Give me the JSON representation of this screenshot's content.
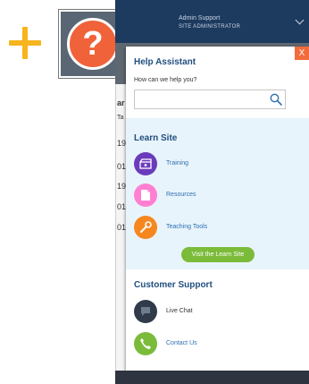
{
  "user": {
    "name": "Admin Support",
    "role": "SITE ADMINISTRATOR"
  },
  "background": {
    "fragments": [
      "ar",
      "Ta",
      "19",
      "01",
      "19",
      "01",
      "01"
    ]
  },
  "panel": {
    "close_label": "X",
    "help_title": "Help Assistant",
    "help_prompt": "How can we help you?",
    "search_value": ""
  },
  "learn": {
    "title": "Learn Site",
    "items": [
      {
        "label": "Training",
        "icon": "clapperboard-icon",
        "color": "#6a3cbc"
      },
      {
        "label": "Resources",
        "icon": "document-icon",
        "color": "#ff7fd2"
      },
      {
        "label": "Teaching Tools",
        "icon": "wrench-icon",
        "color": "#f6871f"
      }
    ],
    "button_label": "Visit the Learn Site"
  },
  "support": {
    "title": "Customer Support",
    "items": [
      {
        "label": "Live Chat",
        "icon": "chat-bubble-icon",
        "color": "#2f3a4a"
      },
      {
        "label": "Contact Us",
        "icon": "phone-icon",
        "color": "#7bbb3a"
      }
    ]
  },
  "colors": {
    "header": "#1d3a5f",
    "accent_orange": "#f26b3a",
    "accent_green": "#7bbb3a",
    "heading_blue": "#214f7f",
    "plus_yellow": "#f6b51e"
  }
}
